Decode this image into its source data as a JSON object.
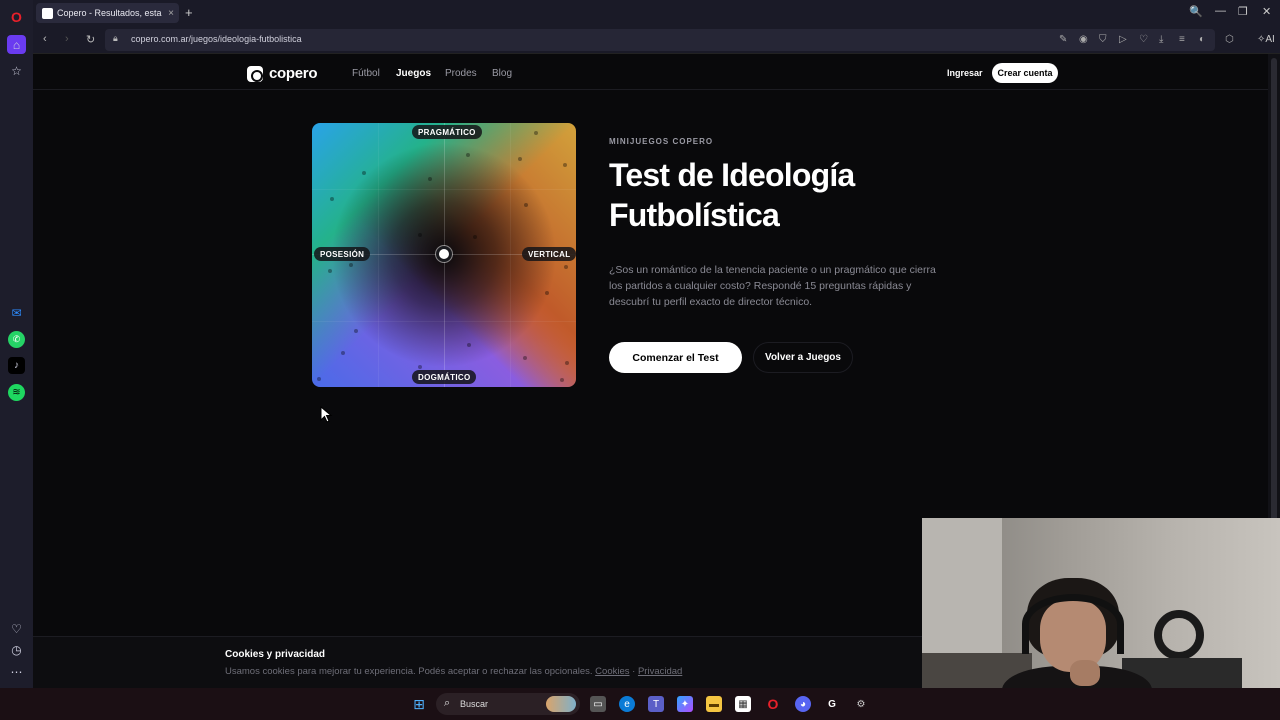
{
  "browser": {
    "tab_title": "Copero - Resultados, esta",
    "tab_close": "×",
    "new_tab": "+",
    "url": "copero.com.ar/juegos/ideologia-futbolistica",
    "window_controls": [
      "🔍",
      "—",
      "❐",
      "✕"
    ],
    "ai_label": "AI"
  },
  "site": {
    "brand": "copero",
    "nav": [
      "Fútbol",
      "Juegos",
      "Prodes",
      "Blog"
    ],
    "login": "Ingresar",
    "signup": "Crear cuenta"
  },
  "compass": {
    "top": "PRAGMÁTICO",
    "bottom": "DOGMÁTICO",
    "left": "POSESIÓN",
    "right": "VERTICAL"
  },
  "hero": {
    "eyebrow": "MINIJUEGOS COPERO",
    "title_line1": "Test de Ideología",
    "title_line2": "Futbolística",
    "description": "¿Sos un romántico de la tenencia paciente o un pragmático que cierra los partidos a cualquier costo? Respondé 15 preguntas rápidas y descubrí tu perfil exacto de director técnico.",
    "start_button": "Comenzar el Test",
    "back_button": "Volver a Juegos"
  },
  "cookies": {
    "title": "Cookies y privacidad",
    "text": "Usamos cookies para mejorar tu experiencia. Podés aceptar o rechazar las opcionales.",
    "link1": "Cookies",
    "separator": "·",
    "link2": "Privacidad"
  },
  "taskbar": {
    "search_label": "Buscar"
  },
  "colors": {
    "accent_rail": "#6a3bf0",
    "page_bg": "#09090b",
    "opera_red": "#e8202a"
  }
}
